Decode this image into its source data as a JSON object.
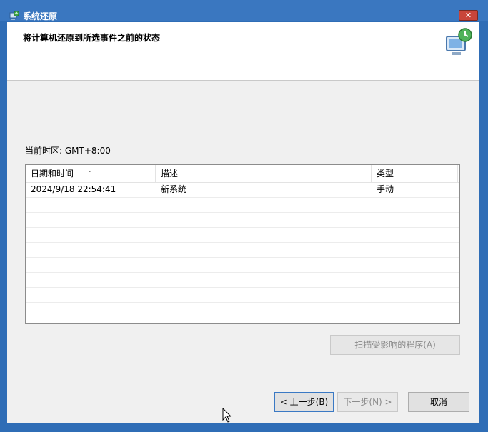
{
  "window": {
    "title": "系统还原",
    "close_label": "✕"
  },
  "header": {
    "title": "将计算机还原到所选事件之前的状态"
  },
  "timezone_label": "当前时区: GMT+8:00",
  "table": {
    "columns": [
      "日期和时间",
      "描述",
      "类型"
    ],
    "sort_indicator": "⌄",
    "rows": [
      {
        "date": "2024/9/18 22:54:41",
        "description": "新系统",
        "type": "手动"
      }
    ]
  },
  "buttons": {
    "scan": "扫描受影响的程序(A)",
    "back": "< 上一步(B)",
    "next": "下一步(N) >",
    "cancel": "取消"
  },
  "colors": {
    "title_bar": "#3a77c0",
    "accent": "#3a79c4"
  }
}
